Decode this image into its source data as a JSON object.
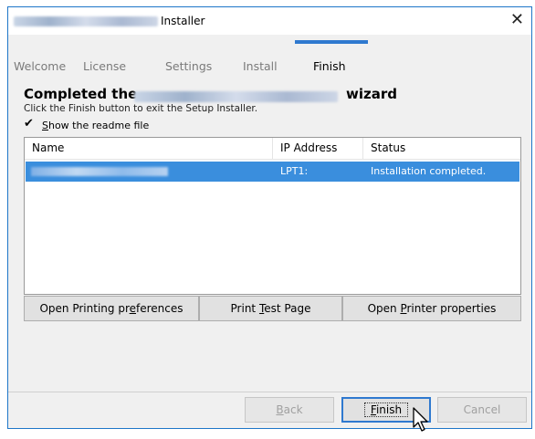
{
  "window": {
    "title": "Installer",
    "close_icon": "close-icon"
  },
  "steps": [
    "Welcome",
    "License",
    "Settings",
    "Install",
    "Finish"
  ],
  "active_step": "Finish",
  "heading": {
    "prefix": "Completed the",
    "suffix": "wizard"
  },
  "subtitle": "Click the Finish button to exit the Setup Installer.",
  "readme": {
    "label_access": "S",
    "label_rest": "how the readme file",
    "checked": true
  },
  "list": {
    "columns": [
      "Name",
      "IP Address",
      "Status"
    ],
    "rows": [
      {
        "ip": "LPT1:",
        "status": "Installation completed."
      }
    ]
  },
  "actions": {
    "open_prefs": {
      "before": "Open Printing pr",
      "access": "e",
      "after": "ferences"
    },
    "print_test": {
      "before": "Print ",
      "access": "T",
      "after": "est Page"
    },
    "open_props": {
      "before": "Open ",
      "access": "P",
      "after": "rinter properties"
    }
  },
  "nav": {
    "back": {
      "access": "B",
      "after": "ack"
    },
    "finish": {
      "access": "F",
      "after": "inish"
    },
    "cancel": "Cancel"
  },
  "colors": {
    "accent": "#2f79cf",
    "selection": "#3a8edd"
  }
}
